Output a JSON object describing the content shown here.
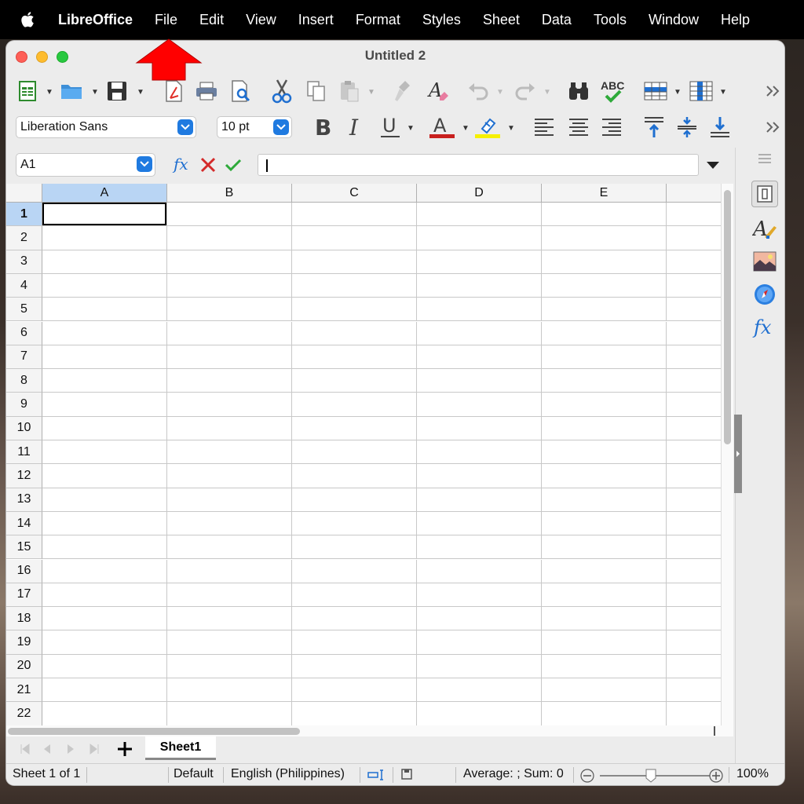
{
  "menubar": {
    "app": "LibreOffice",
    "items": [
      "File",
      "Edit",
      "View",
      "Insert",
      "Format",
      "Styles",
      "Sheet",
      "Data",
      "Tools",
      "Window",
      "Help"
    ]
  },
  "window": {
    "title": "Untitled 2"
  },
  "toolbar": {
    "font_name": "Liberation Sans",
    "font_size": "10 pt"
  },
  "formula_bar": {
    "name_box": "A1",
    "input_value": ""
  },
  "grid": {
    "columns": [
      "A",
      "B",
      "C",
      "D",
      "E"
    ],
    "rows": [
      "1",
      "2",
      "3",
      "4",
      "5",
      "6",
      "7",
      "8",
      "9",
      "10",
      "11",
      "12",
      "13",
      "14",
      "15",
      "16",
      "17",
      "18",
      "19",
      "20",
      "21",
      "22"
    ],
    "selected_cell": "A1"
  },
  "sheet_tabs": {
    "tabs": [
      "Sheet1"
    ]
  },
  "status_bar": {
    "sheet_info": "Sheet 1 of 1",
    "page_style": "Default",
    "language": "English (Philippines)",
    "summary": "Average: ; Sum: 0",
    "zoom": "100%"
  },
  "colors": {
    "accent": "#1f7ae0",
    "selection": "#b9d5f4",
    "annotation_arrow": "#ff0000"
  }
}
